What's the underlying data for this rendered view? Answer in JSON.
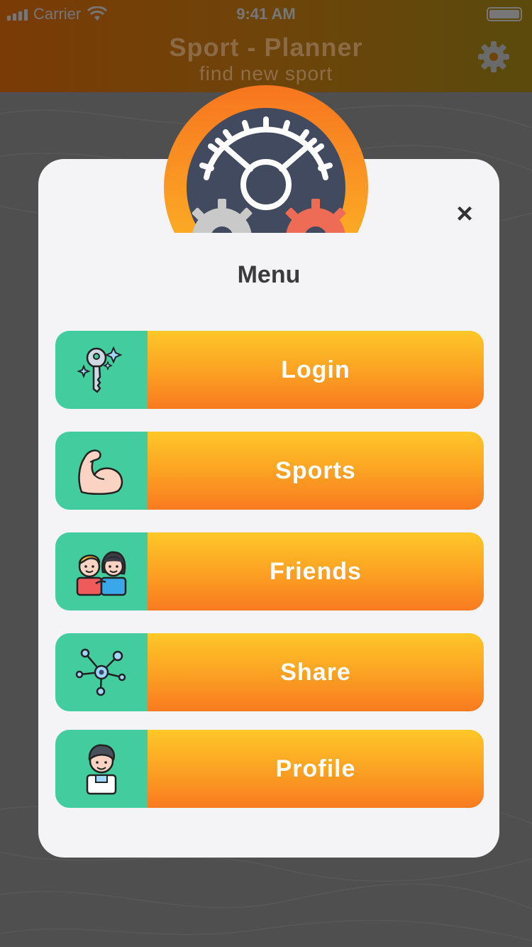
{
  "statusbar": {
    "carrier": "Carrier",
    "time": "9:41 AM"
  },
  "header": {
    "title": "Sport - Planner",
    "subtitle": "find new sport",
    "settings_icon": "gear-icon"
  },
  "modal": {
    "title": "Menu",
    "close_label": "×",
    "logo_icon": "gears-logo-icon",
    "items": [
      {
        "label": "Login",
        "icon": "key-icon"
      },
      {
        "label": "Sports",
        "icon": "flexed-bicep-icon"
      },
      {
        "label": "Friends",
        "icon": "friends-icon"
      },
      {
        "label": "Share",
        "icon": "network-share-icon"
      },
      {
        "label": "Profile",
        "icon": "user-profile-icon"
      }
    ]
  },
  "colors": {
    "accent_teal": "#43cd9f",
    "button_gradient_top": "#fec729",
    "button_gradient_bottom": "#f87a20",
    "modal_bg": "#f4f4f6"
  }
}
